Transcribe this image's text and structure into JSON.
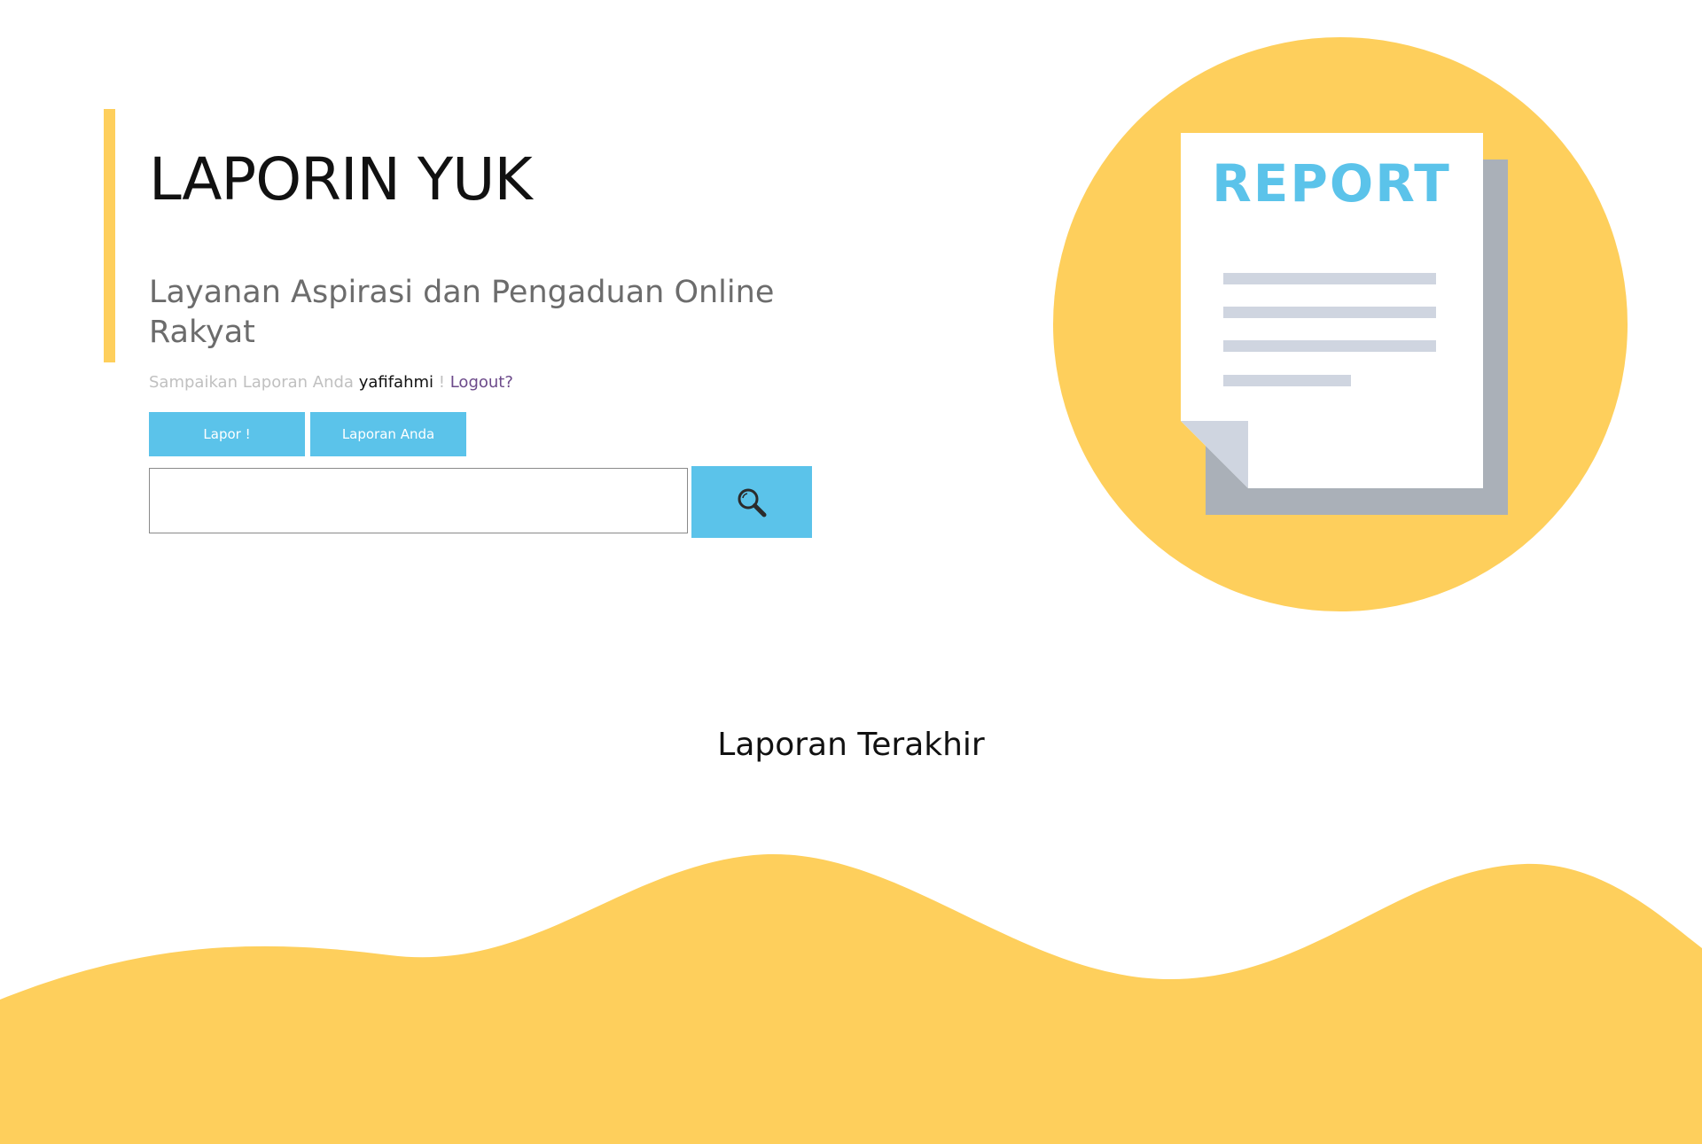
{
  "header": {
    "title": "LAPORIN YUK",
    "tagline": "Layanan Aspirasi dan Pengaduan Online Rakyat"
  },
  "greeting": {
    "prefix": "Sampaikan Laporan Anda",
    "username": "yafifahmi",
    "separator": "!",
    "logout_label": "Logout?"
  },
  "actions": {
    "lapor_label": "Lapor !",
    "laporan_anda_label": "Laporan Anda"
  },
  "search": {
    "value": "",
    "placeholder": "",
    "icon": "search-icon"
  },
  "illustration": {
    "label": "REPORT",
    "icon": "report-document-icon"
  },
  "section": {
    "latest_title": "Laporan Terakhir"
  },
  "colors": {
    "accent_yellow": "#fecf5c",
    "button_blue": "#5bc3ea",
    "report_text_blue": "#5bc3ea",
    "doc_shadow_gray": "#aab0b8",
    "doc_line_gray": "#cfd5e0"
  }
}
